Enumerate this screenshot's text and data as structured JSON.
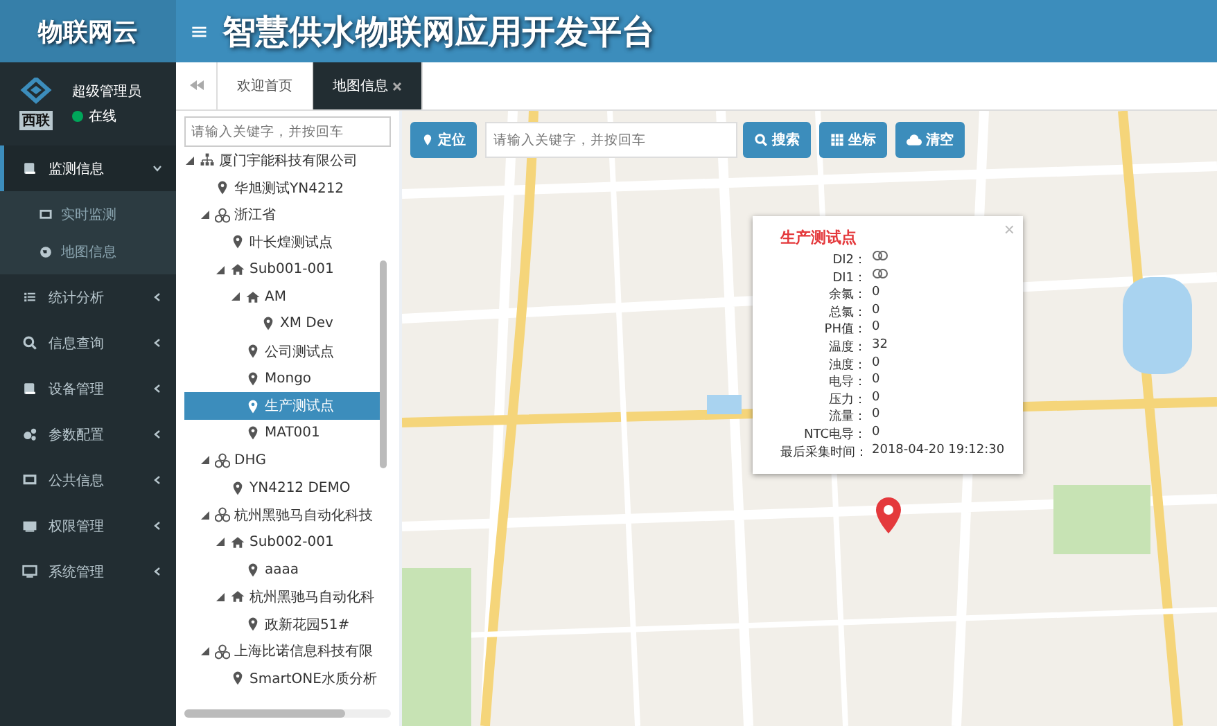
{
  "brand": {
    "title": "物联网云",
    "menu_icon": "≡",
    "app_title": "智慧供水物联网应用开发平台"
  },
  "user": {
    "logo_text": "西联",
    "name": "超级管理员",
    "status": "在线",
    "online": true
  },
  "sidebar": {
    "items": [
      {
        "label": "监测信息",
        "kind": "book",
        "expanded": true,
        "children": [
          {
            "label": "实时监测",
            "kind": "monitor"
          },
          {
            "label": "地图信息",
            "kind": "globe"
          }
        ]
      },
      {
        "label": "统计分析",
        "kind": "list",
        "expanded": false
      },
      {
        "label": "信息查询",
        "kind": "search",
        "expanded": false
      },
      {
        "label": "设备管理",
        "kind": "book",
        "expanded": false
      },
      {
        "label": "参数配置",
        "kind": "gears",
        "expanded": false
      },
      {
        "label": "公共信息",
        "kind": "monitor",
        "expanded": false
      },
      {
        "label": "权限管理",
        "kind": "card",
        "expanded": false
      },
      {
        "label": "系统管理",
        "kind": "desktop",
        "expanded": false
      }
    ]
  },
  "tabs": [
    {
      "label": "欢迎首页",
      "selected": false,
      "closable": false
    },
    {
      "label": "地图信息",
      "selected": true,
      "closable": true
    }
  ],
  "tree": {
    "placeholder": "请输入关键字，并按回车",
    "nodes": [
      {
        "label": "厦门宇能科技有限公司",
        "kind": "org",
        "expanded": true,
        "selected": false,
        "children": [
          {
            "label": "华旭测试YN4212",
            "kind": "point",
            "selected": false
          },
          {
            "label": "浙江省",
            "kind": "group",
            "expanded": true,
            "selected": false,
            "children": [
              {
                "label": "叶长煌测试点",
                "kind": "point",
                "selected": false
              },
              {
                "label": "Sub001-001",
                "kind": "site",
                "expanded": true,
                "selected": false,
                "children": [
                  {
                    "label": "AM",
                    "kind": "site",
                    "expanded": true,
                    "selected": false,
                    "children": [
                      {
                        "label": "XM Dev",
                        "kind": "point",
                        "selected": false
                      }
                    ]
                  },
                  {
                    "label": "公司测试点",
                    "kind": "point",
                    "selected": false
                  },
                  {
                    "label": "Mongo",
                    "kind": "point",
                    "selected": false
                  },
                  {
                    "label": "生产测试点",
                    "kind": "point",
                    "selected": true
                  },
                  {
                    "label": "MAT001",
                    "kind": "point",
                    "selected": false
                  }
                ]
              }
            ]
          },
          {
            "label": "DHG",
            "kind": "group",
            "expanded": true,
            "selected": false,
            "children": [
              {
                "label": "YN4212 DEMO",
                "kind": "point",
                "selected": false
              }
            ]
          },
          {
            "label": "杭州黑驰马自动化科技",
            "kind": "group",
            "expanded": true,
            "selected": false,
            "children": [
              {
                "label": "Sub002-001",
                "kind": "site",
                "expanded": true,
                "selected": false,
                "children": [
                  {
                    "label": "aaaa",
                    "kind": "point",
                    "selected": false
                  }
                ]
              },
              {
                "label": "杭州黑驰马自动化科",
                "kind": "site",
                "expanded": true,
                "selected": false,
                "children": [
                  {
                    "label": "政新花园51#",
                    "kind": "point",
                    "selected": false
                  }
                ]
              }
            ]
          },
          {
            "label": "上海比诺信息科技有限",
            "kind": "group",
            "expanded": true,
            "selected": false,
            "children": [
              {
                "label": "SmartONE水质分析",
                "kind": "point",
                "selected": false
              }
            ]
          }
        ]
      }
    ]
  },
  "map_toolbar": {
    "locate": "定位",
    "placeholder": "请输入关键字，并按回车",
    "search": "搜索",
    "coords": "坐标",
    "clear": "清空"
  },
  "popup": {
    "title": "生产测试点",
    "close": "×",
    "rows": [
      {
        "label": "DI2：",
        "kind": "switch"
      },
      {
        "label": "DI1：",
        "kind": "switch"
      },
      {
        "label": "余氯：",
        "kind": "text",
        "value": "0"
      },
      {
        "label": "总氯：",
        "kind": "text",
        "value": "0"
      },
      {
        "label": "PH值：",
        "kind": "text",
        "value": "0"
      },
      {
        "label": "温度：",
        "kind": "text",
        "value": "32"
      },
      {
        "label": "浊度：",
        "kind": "text",
        "value": "0"
      },
      {
        "label": "电导：",
        "kind": "text",
        "value": "0"
      },
      {
        "label": "压力：",
        "kind": "text",
        "value": "0"
      },
      {
        "label": "流量：",
        "kind": "text",
        "value": "0"
      },
      {
        "label": "NTC电导：",
        "kind": "text",
        "value": "0"
      },
      {
        "label": "最后采集时间：",
        "kind": "text",
        "value": "2018-04-20 19:12:30"
      }
    ]
  }
}
